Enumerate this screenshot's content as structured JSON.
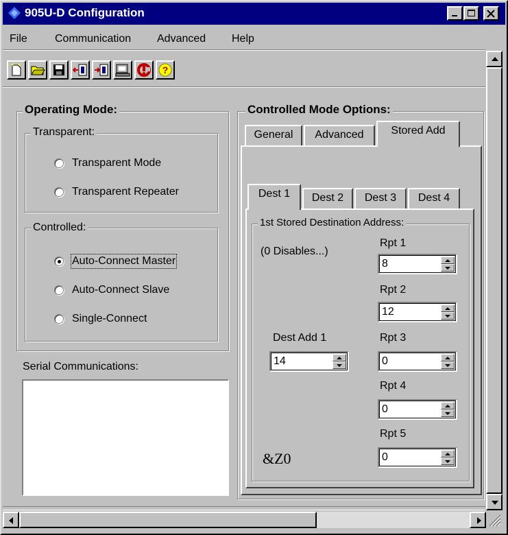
{
  "window": {
    "title": "905U-D Configuration"
  },
  "menu": [
    "File",
    "Communication",
    "Advanced",
    "Help"
  ],
  "toolbar": {
    "buttons": [
      "new-icon",
      "open-icon",
      "save-icon",
      "read-icon",
      "write-icon",
      "terminal-icon",
      "reset-icon",
      "help-icon"
    ]
  },
  "operating_mode": {
    "label": "Operating Mode:",
    "transparent": {
      "label": "Transparent:",
      "options": [
        "Transparent Mode",
        "Transparent Repeater"
      ]
    },
    "controlled": {
      "label": "Controlled:",
      "options": [
        "Auto-Connect Master",
        "Auto-Connect Slave",
        "Single-Connect"
      ],
      "selected": "Auto-Connect Master"
    }
  },
  "serial": {
    "label": "Serial Communications:"
  },
  "controlled_options": {
    "label": "Controlled Mode Options:",
    "tabs": [
      "General",
      "Advanced",
      "Stored Add"
    ],
    "active_tab": "Stored Add",
    "dest_tabs": [
      "Dest 1",
      "Dest 2",
      "Dest 3",
      "Dest 4"
    ],
    "active_dest_tab": "Dest 1",
    "group_label": "1st Stored Destination Address:",
    "note": "(0 Disables...)",
    "dest_add_label": "Dest Add 1",
    "dest_add_value": "14",
    "repeaters": [
      {
        "label": "Rpt 1",
        "value": "8"
      },
      {
        "label": "Rpt 2",
        "value": "12"
      },
      {
        "label": "Rpt 3",
        "value": "0"
      },
      {
        "label": "Rpt 4",
        "value": "0"
      },
      {
        "label": "Rpt 5",
        "value": "0"
      }
    ],
    "command": "&Z0"
  }
}
